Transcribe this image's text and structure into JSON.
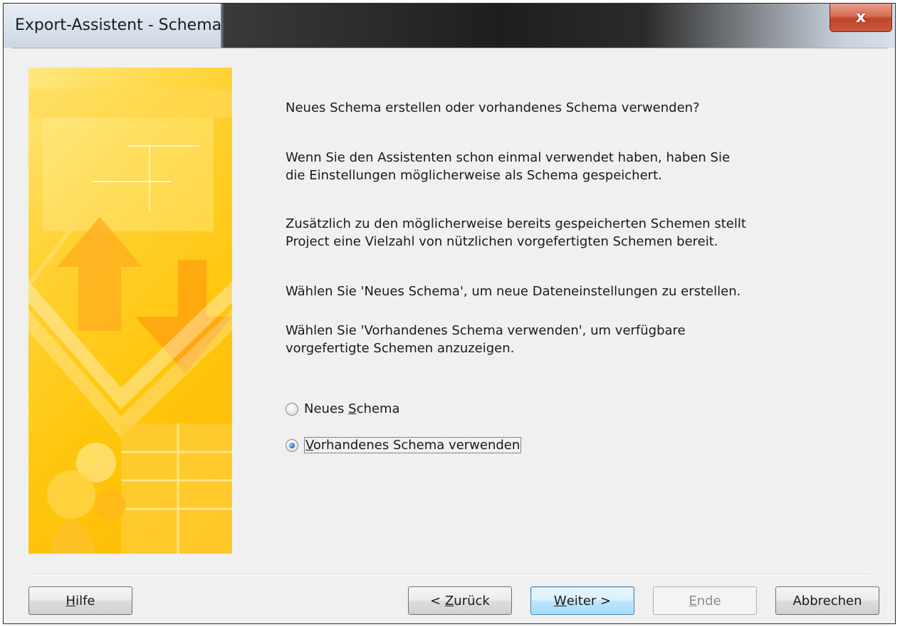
{
  "window": {
    "title": "Export-Assistent - Schema",
    "close_symbol": "x"
  },
  "content": {
    "question": "Neues Schema erstellen oder vorhandenes Schema verwenden?",
    "para1_line1": "Wenn Sie den Assistenten schon einmal verwendet haben, haben Sie",
    "para1_line2": "die Einstellungen möglicherweise als Schema gespeichert.",
    "para2_line1": "Zusätzlich zu den möglicherweise bereits gespeicherten Schemen stellt",
    "para2_line2": "Project eine Vielzahl von nützlichen vorgefertigten Schemen bereit.",
    "para3": "Wählen Sie 'Neues Schema', um neue Dateneinstellungen zu erstellen.",
    "para4_line1": "Wählen Sie 'Vorhandenes Schema verwenden', um verfügbare",
    "para4_line2": "vorgefertigte Schemen anzuzeigen."
  },
  "options": {
    "new_schema": {
      "pre": "Neues ",
      "accel": "S",
      "post": "chema",
      "selected": false
    },
    "existing_schema": {
      "pre": "",
      "accel": "V",
      "post": "orhandenes Schema verwenden",
      "selected": true
    }
  },
  "buttons": {
    "help": {
      "pre": "",
      "accel": "H",
      "post": "ilfe"
    },
    "back": {
      "pre": "< ",
      "accel": "Z",
      "post": "urück"
    },
    "next": {
      "pre": "",
      "accel": "W",
      "post": "eiter >"
    },
    "finish": {
      "pre": "",
      "accel": "E",
      "post": "nde"
    },
    "cancel": {
      "pre": "",
      "accel": "",
      "post": "Abbrechen"
    }
  },
  "colors": {
    "banner_primary": "#ffc70f",
    "default_button_border": "#3c7fb1",
    "close_button": "#c0442a"
  }
}
